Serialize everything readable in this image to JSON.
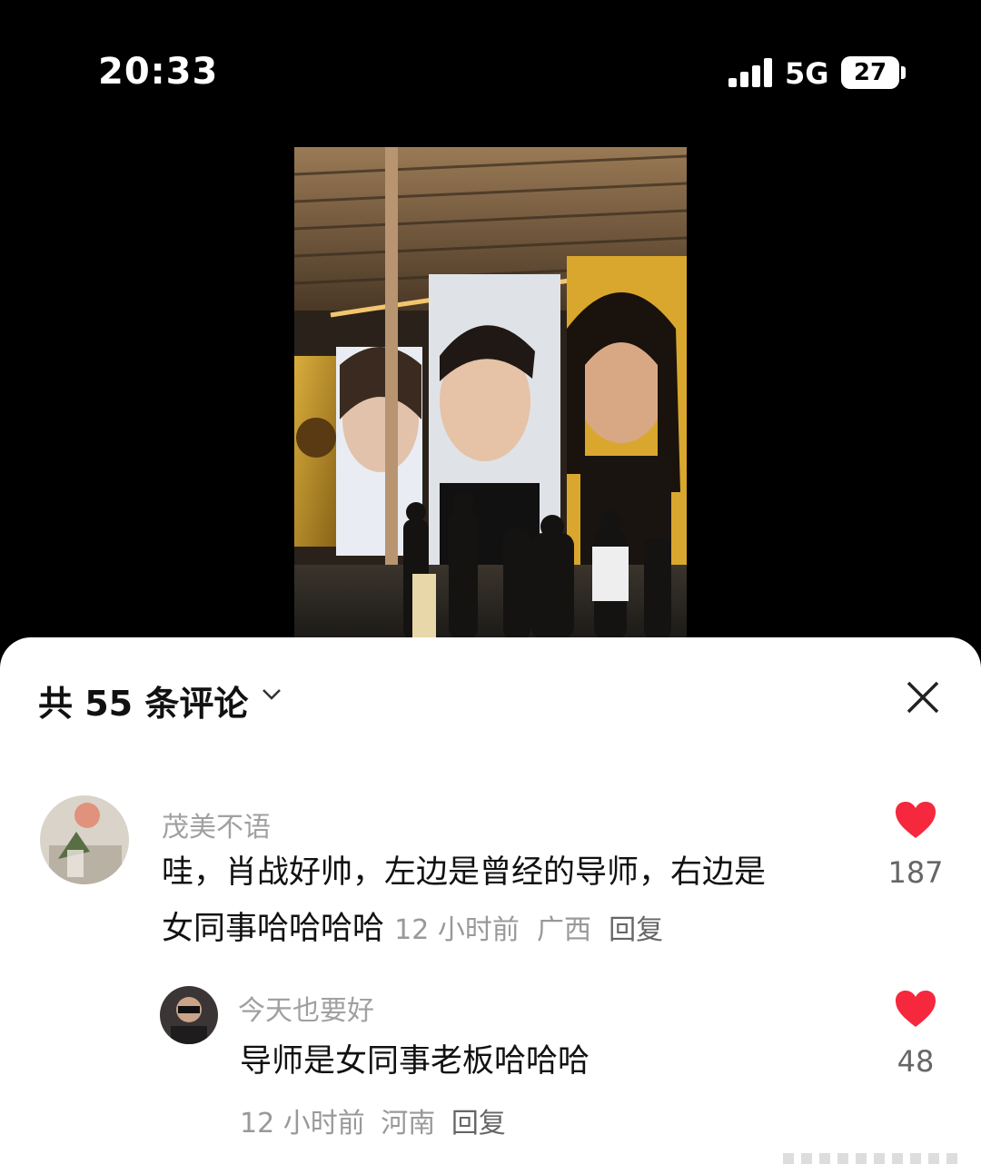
{
  "status": {
    "time": "20:33",
    "network": "5G",
    "battery": "27"
  },
  "comments_header": {
    "title": "共 55 条评论"
  },
  "comments": [
    {
      "username": "茂美不语",
      "text_line1": "哇，肖战好帅，左边是曾经的导师，右边是",
      "text_line2": "女同事哈哈哈哈",
      "time": "12 小时前",
      "location": "广西",
      "reply_label": "回复",
      "likes": "187"
    }
  ],
  "reply": {
    "username": "今天也要好",
    "text": "导师是女同事老板哈哈哈",
    "time": "12 小时前",
    "location": "河南",
    "reply_label": "回复",
    "likes": "48"
  },
  "colors": {
    "heart": "#f5283d",
    "sheet": "#ffffff",
    "background": "#000000"
  },
  "icons": [
    "signal-icon",
    "battery-icon",
    "chevron-down-icon",
    "close-icon",
    "heart-icon"
  ]
}
